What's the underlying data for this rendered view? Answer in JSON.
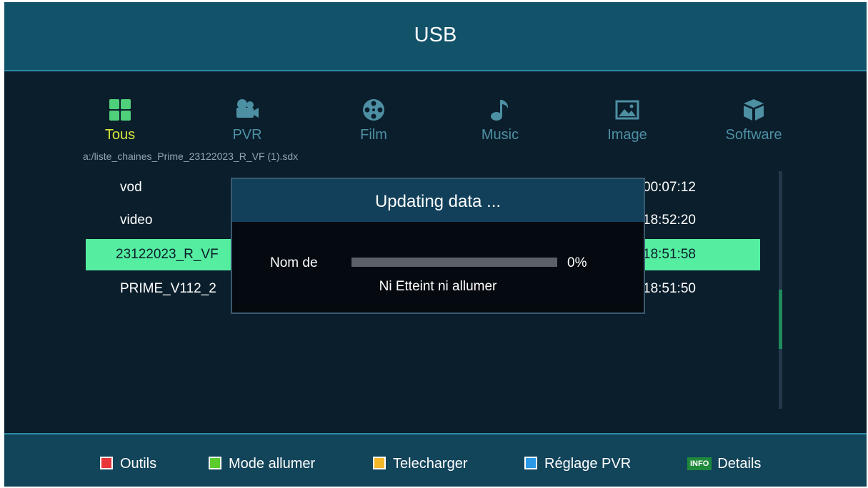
{
  "header": {
    "title": "USB"
  },
  "categories": [
    {
      "label": "Tous",
      "icon": "grid-icon",
      "active": true
    },
    {
      "label": "PVR",
      "icon": "camera-icon",
      "active": false
    },
    {
      "label": "Film",
      "icon": "film-reel-icon",
      "active": false
    },
    {
      "label": "Music",
      "icon": "music-note-icon",
      "active": false
    },
    {
      "label": "Image",
      "icon": "picture-icon",
      "active": false
    },
    {
      "label": "Software",
      "icon": "box-icon",
      "active": false
    }
  ],
  "path": "a:/liste_chaines_Prime_23122023_R_VF (1).sdx",
  "files": [
    {
      "name": "vod",
      "time": "00:07:12"
    },
    {
      "name": "video",
      "time": "18:52:20"
    },
    {
      "name": "23122023_R_VF",
      "time": "18:51:58"
    },
    {
      "name": "PRIME_V112_2",
      "time": "18:51:50"
    }
  ],
  "selected_index": 2,
  "scroll_position": 0.5,
  "dialog": {
    "title": "Updating data ...",
    "label": "Nom de",
    "progress": 0,
    "percent_text": "0%",
    "message": "Ni Etteint ni allumer"
  },
  "footer": [
    {
      "color": "#e8353a",
      "label": "Outils",
      "icon": "red-key-icon"
    },
    {
      "color": "#5ccc2e",
      "label": "Mode allumer",
      "icon": "green-key-icon"
    },
    {
      "color": "#f2b82a",
      "label": "Telecharger",
      "icon": "yellow-key-icon"
    },
    {
      "color": "#2a9ae8",
      "label": "Réglage PVR",
      "icon": "blue-key-icon"
    },
    {
      "badge": "INFO",
      "label": "Details",
      "icon": "info-key-icon"
    }
  ],
  "colors": {
    "accent_yellow": "#d8e63b",
    "selection": "#55eea0",
    "header": "#12536a"
  }
}
